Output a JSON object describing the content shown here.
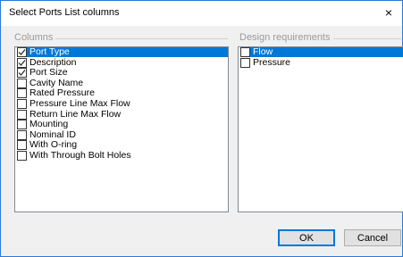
{
  "dialog": {
    "title": "Select Ports List columns",
    "close_glyph": "×"
  },
  "columns_group": {
    "label": "Columns",
    "items": [
      {
        "label": "Port Type",
        "checked": true,
        "selected": true
      },
      {
        "label": "Description",
        "checked": true,
        "selected": false
      },
      {
        "label": "Port Size",
        "checked": true,
        "selected": false
      },
      {
        "label": "Cavity Name",
        "checked": false,
        "selected": false
      },
      {
        "label": "Rated Pressure",
        "checked": false,
        "selected": false
      },
      {
        "label": "Pressure Line Max Flow",
        "checked": false,
        "selected": false
      },
      {
        "label": "Return Line Max Flow",
        "checked": false,
        "selected": false
      },
      {
        "label": "Mounting",
        "checked": false,
        "selected": false
      },
      {
        "label": "Nominal ID",
        "checked": false,
        "selected": false
      },
      {
        "label": "With O-ring",
        "checked": false,
        "selected": false
      },
      {
        "label": "With Through Bolt Holes",
        "checked": false,
        "selected": false
      }
    ]
  },
  "design_group": {
    "label": "Design requirements",
    "items": [
      {
        "label": "Flow",
        "checked": false,
        "selected": true
      },
      {
        "label": "Pressure",
        "checked": false,
        "selected": false
      }
    ]
  },
  "buttons": {
    "ok": "OK",
    "cancel": "Cancel"
  },
  "colors": {
    "accent": "#0078d7",
    "dialog_border": "#2b79d8"
  }
}
